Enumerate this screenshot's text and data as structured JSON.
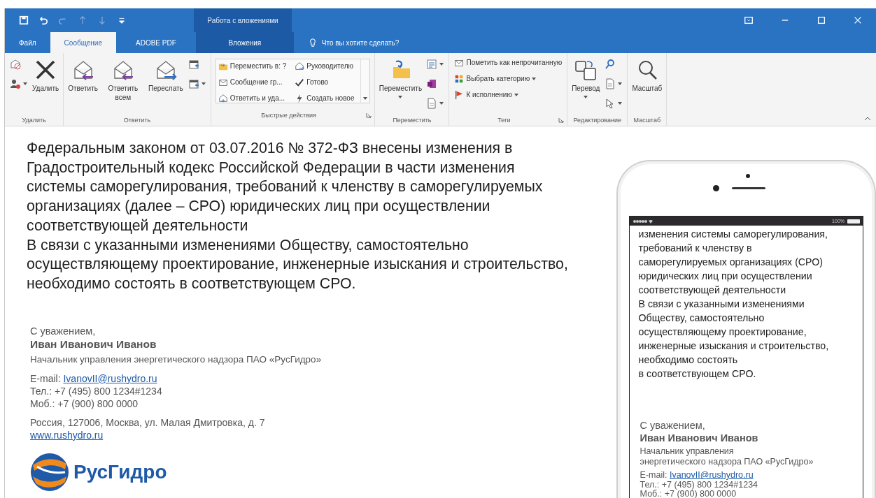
{
  "title_bar": {
    "context_title": "Работа с вложениями"
  },
  "tabs": [
    {
      "label": "Файл",
      "selected": false,
      "kind": "normal"
    },
    {
      "label": "Сообщение",
      "selected": true,
      "kind": "normal"
    },
    {
      "label": "ADOBE PDF",
      "selected": false,
      "kind": "normal"
    },
    {
      "label": "Вложения",
      "selected": false,
      "kind": "context"
    }
  ],
  "tell_me": {
    "label": "Что вы хотите сделать?"
  },
  "ribbon": {
    "groups": [
      {
        "label": "Удалить",
        "launcher": false,
        "columns": [
          [
            {
              "kind": "icon",
              "dropdown": false
            },
            {
              "kind": "icon",
              "dropdown": true
            }
          ],
          [
            {
              "kind": "large",
              "label": "Удалить",
              "dropdown": false
            }
          ]
        ]
      },
      {
        "label": "Ответить",
        "launcher": false,
        "columns": [
          [
            {
              "kind": "large",
              "label": "Ответить",
              "dropdown": false
            }
          ],
          [
            {
              "kind": "large",
              "label": "Ответить всем",
              "dropdown": false
            }
          ],
          [
            {
              "kind": "large",
              "label": "Переслать",
              "dropdown": false
            }
          ],
          [
            {
              "kind": "icon",
              "dropdown": false
            },
            {
              "kind": "icon",
              "dropdown": true
            }
          ]
        ]
      },
      {
        "label": "Быстрые действия",
        "launcher": true,
        "kind": "gallery",
        "columns": [
          [
            {
              "kind": "small",
              "label": "Переместить в: ?",
              "dropdown": false
            },
            {
              "kind": "small",
              "label": "Сообщение гр...",
              "dropdown": false
            },
            {
              "kind": "small",
              "label": "Ответить и уда...",
              "dropdown": false
            }
          ],
          [
            {
              "kind": "small",
              "label": "Руководителю",
              "dropdown": false
            },
            {
              "kind": "small",
              "label": "Готово",
              "dropdown": false
            },
            {
              "kind": "small",
              "label": "Создать новое",
              "dropdown": false
            }
          ]
        ]
      },
      {
        "label": "Переместить",
        "launcher": false,
        "columns": [
          [
            {
              "kind": "large",
              "label": "Переместить",
              "dropdown": true
            }
          ],
          [
            {
              "kind": "icon",
              "dropdown": true
            },
            {
              "kind": "icon",
              "dropdown": false
            },
            {
              "kind": "icon",
              "dropdown": true
            }
          ]
        ]
      },
      {
        "label": "Теги",
        "launcher": true,
        "columns": [
          [
            {
              "kind": "small",
              "label": "Пометить как непрочитанную",
              "dropdown": false
            },
            {
              "kind": "small",
              "label": "Выбрать категорию",
              "dropdown": true
            },
            {
              "kind": "small",
              "label": "К исполнению",
              "dropdown": true
            }
          ]
        ]
      },
      {
        "label": "Редактирование",
        "launcher": false,
        "columns": [
          [
            {
              "kind": "large",
              "label": "Перевод",
              "dropdown": true
            }
          ],
          [
            {
              "kind": "icon",
              "dropdown": false
            },
            {
              "kind": "icon",
              "dropdown": true
            },
            {
              "kind": "icon",
              "dropdown": true
            }
          ]
        ]
      },
      {
        "label": "Масштаб",
        "launcher": false,
        "columns": [
          [
            {
              "kind": "large",
              "label": "Масштаб",
              "dropdown": false
            }
          ]
        ]
      }
    ]
  },
  "message": {
    "paragraphs": [
      "Федеральным законом от 03.07.2016 № 372-ФЗ внесены изменения в Градостроительный кодекс Российской Федерации в части изменения системы саморегулирования, требований к членству в саморегулируемых организациях (далее – СРО) юридических лиц при осуществлении соответствующей деятельности",
      "В связи с указанными изменениями Обществу, самостоятельно осуществляющему проектирование, инженерные изыскания и строительство, необходимо состоять в соответствующем СРО."
    ],
    "signature": {
      "greeting": "С уважением,",
      "name": "Иван Иванович Иванов",
      "position": "Начальник управления энергетического надзора ПАО «РусГидро»",
      "email_label": "E-mail: ",
      "email": "IvanovII@rushydro.ru",
      "phone": "Тел.: +7 (495) 800 1234#1234",
      "mobile": "Моб.: +7 (900) 800 0000",
      "address": "Россия, 127006, Москва, ул. Малая Дмитровка, д. 7",
      "website": "www.rushydro.ru",
      "logo_text": "РусГидро"
    }
  },
  "phone": {
    "battery": "100%",
    "paragraphs": [
      "изменения системы саморегулирования, требований к членству в саморегулируемых организациях (СРО) юридических лиц при осуществлении соответствующей деятельности",
      "В связи с указанными изменениями Обществу, самостоятельно осуществляющему проектирование, инженерные изыскания и строительство, необходимо состоять\nв соответствующем СРО."
    ],
    "signature": {
      "greeting": "С уважением,",
      "name": "Иван Иванович Иванов",
      "position": "Начальник управления\nэнергетического надзора ПАО «РусГидро»",
      "email_label": "E-mail: ",
      "email": "IvanovII@rushydro.ru",
      "phone": "Тел.: +7 (495) 800 1234#1234",
      "mobile": "Моб.: +7 (900) 800 0000"
    }
  }
}
